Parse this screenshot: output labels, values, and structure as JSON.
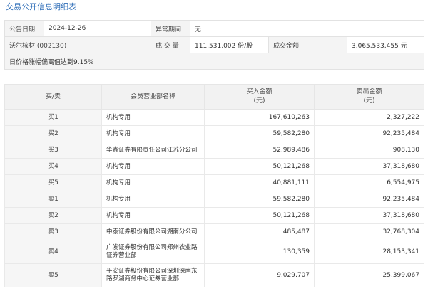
{
  "title": "交易公开信息明细表",
  "info": {
    "date_label": "公告日期",
    "date_value": "2024-12-26",
    "abnormal_label": "异常期间",
    "abnormal_value": "无",
    "stock": "沃尔核材 (002130)",
    "volume_label": "成 交 量",
    "volume_value": "111,531,002 份/股",
    "amount_label": "成交金额",
    "amount_value": "3,065,533,455 元",
    "reason": "日价格涨幅偏离值达到9.15%"
  },
  "table": {
    "headers": {
      "side": "买/卖",
      "name": "会员营业部名称",
      "buy": "买入金额\n(元)",
      "sell": "卖出金额\n(元)"
    },
    "rows": [
      {
        "side": "买1",
        "name": "机构专用",
        "buy": "167,610,263",
        "sell": "2,327,222"
      },
      {
        "side": "买2",
        "name": "机构专用",
        "buy": "59,582,280",
        "sell": "92,235,484"
      },
      {
        "side": "买3",
        "name": "华鑫证券有限责任公司江苏分公司",
        "buy": "52,989,486",
        "sell": "908,130"
      },
      {
        "side": "买4",
        "name": "机构专用",
        "buy": "50,121,268",
        "sell": "37,318,680"
      },
      {
        "side": "买5",
        "name": "机构专用",
        "buy": "40,881,111",
        "sell": "6,554,975"
      },
      {
        "side": "卖1",
        "name": "机构专用",
        "buy": "59,582,280",
        "sell": "92,235,484"
      },
      {
        "side": "卖2",
        "name": "机构专用",
        "buy": "50,121,268",
        "sell": "37,318,680"
      },
      {
        "side": "卖3",
        "name": "中泰证券股份有限公司湖南分公司",
        "buy": "485,487",
        "sell": "32,768,304"
      },
      {
        "side": "卖4",
        "name": "广发证券股份有限公司郑州农业路证券营业部",
        "buy": "130,359",
        "sell": "28,153,341"
      },
      {
        "side": "卖5",
        "name": "平安证券股份有限公司深圳深南东路罗湖商务中心证券营业部",
        "buy": "9,029,707",
        "sell": "25,399,067"
      }
    ]
  }
}
